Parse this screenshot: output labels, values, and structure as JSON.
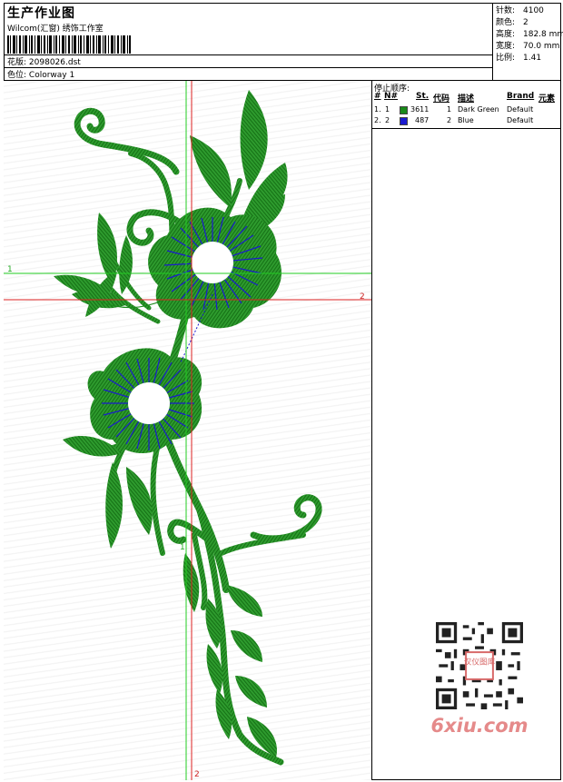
{
  "header": {
    "title": "生产作业图",
    "subtitle": "Wilcom(汇窗) 绣饰工作室",
    "design_label": "花版:",
    "design_value": "2098026.dst",
    "colorway_label": "色位:",
    "colorway_value": "Colorway 1"
  },
  "stats": [
    {
      "label": "针数:",
      "value": "4100"
    },
    {
      "label": "颜色:",
      "value": "2"
    },
    {
      "label": "高度:",
      "value": "182.8 mm"
    },
    {
      "label": "宽度:",
      "value": "70.0 mm"
    },
    {
      "label": "比例:",
      "value": "1.41"
    }
  ],
  "stop_sequence": {
    "title": "停止顺序:",
    "headers": {
      "num": "#",
      "n": "N#",
      "st": "St.",
      "code": "代码",
      "desc": "描述",
      "brand": "Brand",
      "elem": "元素"
    },
    "rows": [
      {
        "num": "1.",
        "n": "1",
        "st": "3611",
        "code": "1",
        "desc": "Dark Green",
        "brand": "Default",
        "color": "#1a8a1a"
      },
      {
        "num": "2.",
        "n": "2",
        "st": "487",
        "code": "2",
        "desc": "Blue",
        "brand": "Default",
        "color": "#1a1ad0"
      }
    ]
  },
  "canvas": {
    "axis_green_label_h": "1",
    "axis_red_label_h": "2",
    "axis_green_label_v": "1",
    "axis_red_label_v": "2",
    "thread_green": "#1a8a1a",
    "thread_blue": "#1a1ad0"
  },
  "watermark": {
    "text": "6xiu.com",
    "badge": "汉仪图库"
  }
}
